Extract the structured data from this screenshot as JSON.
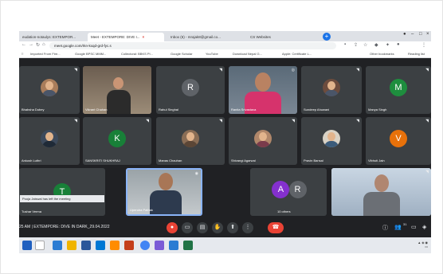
{
  "browser": {
    "tabs": [
      {
        "label": "eudation-notaulys: EXTEMPOR...",
        "active": false
      },
      {
        "label": "Meet - EXTEMPORE: DIVE I...",
        "active": true
      },
      {
        "label": "Inbox (6) - mrajak8@gmail.co...",
        "active": false
      },
      {
        "label": "CS Websites",
        "active": false
      }
    ],
    "url": "meet.google.com/rkn-kxqd-grd-fyc.s",
    "bookmarks": [
      "Imported From Fire...",
      "Google BPSC MMM...",
      "Collectoral: BBKS Pl...",
      "Google Scholar",
      "YouTube",
      "Download Nepal G...",
      "Apple: Certificate L...",
      "Other bookmarks",
      "Reading list"
    ]
  },
  "participants": [
    {
      "name": "Bhabsha Dubey",
      "kind": "photo"
    },
    {
      "name": "Vikrant Chahan",
      "kind": "video"
    },
    {
      "name": "Rahul Singhal",
      "kind": "letter",
      "letter": "R",
      "color": "#5f6368"
    },
    {
      "name": "Ranita Srivastava",
      "kind": "video"
    },
    {
      "name": "Sundeep Ahuwani",
      "kind": "photo"
    },
    {
      "name": "Manya Singh",
      "kind": "letter",
      "letter": "M",
      "color": "#1e8e3e"
    },
    {
      "name": "Ankush Luthri",
      "kind": "photo"
    },
    {
      "name": "SANSKRITI SHUKHRAJ",
      "kind": "letter",
      "letter": "K",
      "color": "#188038"
    },
    {
      "name": "Manas Chauhan",
      "kind": "photo"
    },
    {
      "name": "Shivangi Agarwal",
      "kind": "photo"
    },
    {
      "name": "Pravin Bansal",
      "kind": "photo"
    },
    {
      "name": "Vibhuti Jain",
      "kind": "letter",
      "letter": "V",
      "color": "#e8710a"
    },
    {
      "name": "Tushar Verma",
      "kind": "letter",
      "letter": "T",
      "color": "#188038"
    },
    {
      "name": "Upendra Pathak",
      "kind": "video"
    },
    {
      "name": "10 others",
      "kind": "group",
      "letters": [
        "A",
        "R"
      ]
    },
    {
      "name": "",
      "kind": "presenter"
    }
  ],
  "toast": "Pooja Jaiswal has left the meeting",
  "controls": {
    "meeting_info": "25 AM  |  EXTEMPORE: DIVE IN DARK_29.04.2022",
    "participant_count": "31"
  },
  "colors": {
    "accent": "#1a73e8",
    "danger": "#ea4335",
    "meet_bg": "#202124",
    "tile_bg": "#3c4043"
  }
}
